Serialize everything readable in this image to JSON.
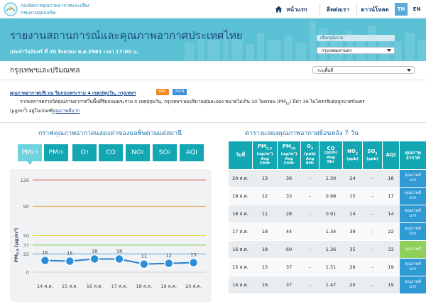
{
  "header": {
    "org_line1": "กองจัดการคุณภาพอากาศและเสียง",
    "org_line2": "กรมควบคุมมลพิษ",
    "nav": [
      {
        "label": "หน้าแรก"
      },
      {
        "label": "ติดต่อเรา"
      },
      {
        "label": "ดาวน์โหลด"
      }
    ],
    "lang_active": "TH",
    "lang_other": "EN"
  },
  "banner": {
    "title": "รายงานสถานการณ์และคุณภาพอากาศประเทศไทย",
    "subtitle": "ประจำวันจันทร์ ที่ 20 สิงหาคม พ.ศ.2561 เวลา 17:00 น.",
    "select_label": "เลือกภูมิภาค",
    "select_value": "กรุงเทพมหานคร"
  },
  "location": {
    "title": "กรุงเทพฯและปริมณฑล",
    "select_value": "ระบุพื้นที่"
  },
  "station": {
    "link": "คุณภาพอากาศบริเวณ ริมถนนพระราม 4 เขตปทุมวัน, กรุงเทพฯ",
    "badge_xml": "XML",
    "badge_json": "JSON",
    "desc_part1": "จากผลการตรวจวัดคุณภาพอากาศในพื้นที่ริมถนนพระราม 4 เขตปทุมวัน, กรุงเทพฯ พบปริมาณฝุ่นละออง ขนาดไม่เกิน 10 ไมครอน (PM",
    "desc_sub1": "10",
    "desc_part2": ") มีค่า 36 ไมโครกรัมต่อลูกบาศก์เมตร",
    "desc_part3": "(µg/m",
    "desc_sup": "3",
    "desc_part4": ") อยู่ในเกณฑ์",
    "desc_quality": "คุณภาพดีมาก"
  },
  "chart_panel": {
    "title": "กราฟคุณภาพอากาศแสดงค่าของมลพิษตามแต่สถานี",
    "tabs": [
      {
        "main": "PM",
        "sub": "2.5"
      },
      {
        "main": "PM",
        "sub": "10"
      },
      {
        "main": "O",
        "sub": "3"
      },
      {
        "main": "CO",
        "sub": ""
      },
      {
        "main": "NO",
        "sub": "2"
      },
      {
        "main": "SO",
        "sub": "2"
      },
      {
        "main": "AQI",
        "sub": ""
      }
    ]
  },
  "chart_data": {
    "type": "line",
    "ylabel": "PM2.5 (µg/m³)",
    "ylabel_main": "PM",
    "ylabel_sub": "2.5",
    "ylabel_unit": " (µg/m³)",
    "categories": [
      "14 ส.ค.",
      "15 ส.ค.",
      "16 ส.ค.",
      "17 ส.ค.",
      "18 ส.ค.",
      "19 ส.ค.",
      "20 ส.ค."
    ],
    "values": [
      16,
      15,
      18,
      18,
      11,
      12,
      13
    ],
    "yticks": [
      0,
      25,
      37,
      50,
      90,
      126
    ],
    "ylim": [
      0,
      135
    ],
    "threshold_lines": [
      {
        "value": 25,
        "color": "#5aa9e6"
      },
      {
        "value": 37,
        "color": "#7ccd5c"
      },
      {
        "value": 50,
        "color": "#e8d84e"
      },
      {
        "value": 90,
        "color": "#f0a248"
      },
      {
        "value": 126,
        "color": "#e05050"
      }
    ],
    "line_color": "#2a7fd0"
  },
  "table_panel": {
    "title": "ตารางแสดงคุณภาพอากาศย้อนหลัง 7 วัน",
    "headers": {
      "date": "วันที่",
      "pm25_main": "PM",
      "pm25_sub": "2.5",
      "pm25_unit": "(ug/m³)",
      "pm25_avg": "Avg",
      "pm25_hr": "24Hr",
      "pm10_main": "PM",
      "pm10_sub": "10",
      "pm10_unit": "(ug/m³)",
      "pm10_avg": "Avg",
      "pm10_hr": "24Hr",
      "o3_main": "O",
      "o3_sub": "3",
      "o3_unit": "(ppb)",
      "o3_avg": "Avg",
      "o3_hr": "8Hr",
      "co_main": "CO",
      "co_unit": "(ppm)",
      "co_avg": "Avg",
      "co_hr": "8hr",
      "no2_main": "NO",
      "no2_sub": "2",
      "no2_unit": "(ppb)",
      "so2_main": "SO",
      "so2_sub": "2",
      "so2_unit": "(ppb)",
      "aqi": "AQI",
      "quality_l1": "คุณภาพ",
      "quality_l2": "อากาศ"
    },
    "rows": [
      {
        "date": "20 ส.ค.",
        "pm25": "13",
        "pm10": "36",
        "o3": "-",
        "co": "1.30",
        "no2": "24",
        "so2": "-",
        "aqi": "18",
        "q1": "คุณภาพดี",
        "q2": "มาก",
        "color": "#2f9ad4"
      },
      {
        "date": "19 ส.ค.",
        "pm25": "12",
        "pm10": "33",
        "o3": "-",
        "co": "0.98",
        "no2": "15",
        "so2": "-",
        "aqi": "17",
        "q1": "คุณภาพดี",
        "q2": "มาก",
        "color": "#2f9ad4"
      },
      {
        "date": "18 ส.ค.",
        "pm25": "11",
        "pm10": "28",
        "o3": "-",
        "co": "0.91",
        "no2": "14",
        "so2": "-",
        "aqi": "14",
        "q1": "คุณภาพดี",
        "q2": "มาก",
        "color": "#2f9ad4"
      },
      {
        "date": "17 ส.ค.",
        "pm25": "18",
        "pm10": "44",
        "o3": "-",
        "co": "1.34",
        "no2": "39",
        "so2": "-",
        "aqi": "22",
        "q1": "คุณภาพดี",
        "q2": "มาก",
        "color": "#2f9ad4"
      },
      {
        "date": "16 ส.ค.",
        "pm25": "18",
        "pm10": "60",
        "o3": "-",
        "co": "1.36",
        "no2": "35",
        "so2": "-",
        "aqi": "33",
        "q1": "คุณภาพดี",
        "q2": "",
        "color": "#8fd05a"
      },
      {
        "date": "15 ส.ค.",
        "pm25": "15",
        "pm10": "37",
        "o3": "-",
        "co": "1.51",
        "no2": "26",
        "so2": "-",
        "aqi": "19",
        "q1": "คุณภาพดี",
        "q2": "มาก",
        "color": "#2f9ad4"
      },
      {
        "date": "14 ส.ค.",
        "pm25": "16",
        "pm10": "37",
        "o3": "-",
        "co": "1.47",
        "no2": "20",
        "so2": "-",
        "aqi": "19",
        "q1": "คุณภาพดี",
        "q2": "มาก",
        "color": "#2f9ad4"
      }
    ]
  },
  "colors": {
    "brand_teal": "#13a6b3",
    "banner": "#5ac0d3",
    "title_blue": "#1d4a80",
    "lang_active": "#5aa9d8",
    "badge_xml": "#f08a24",
    "badge_json": "#3b8fd8"
  }
}
